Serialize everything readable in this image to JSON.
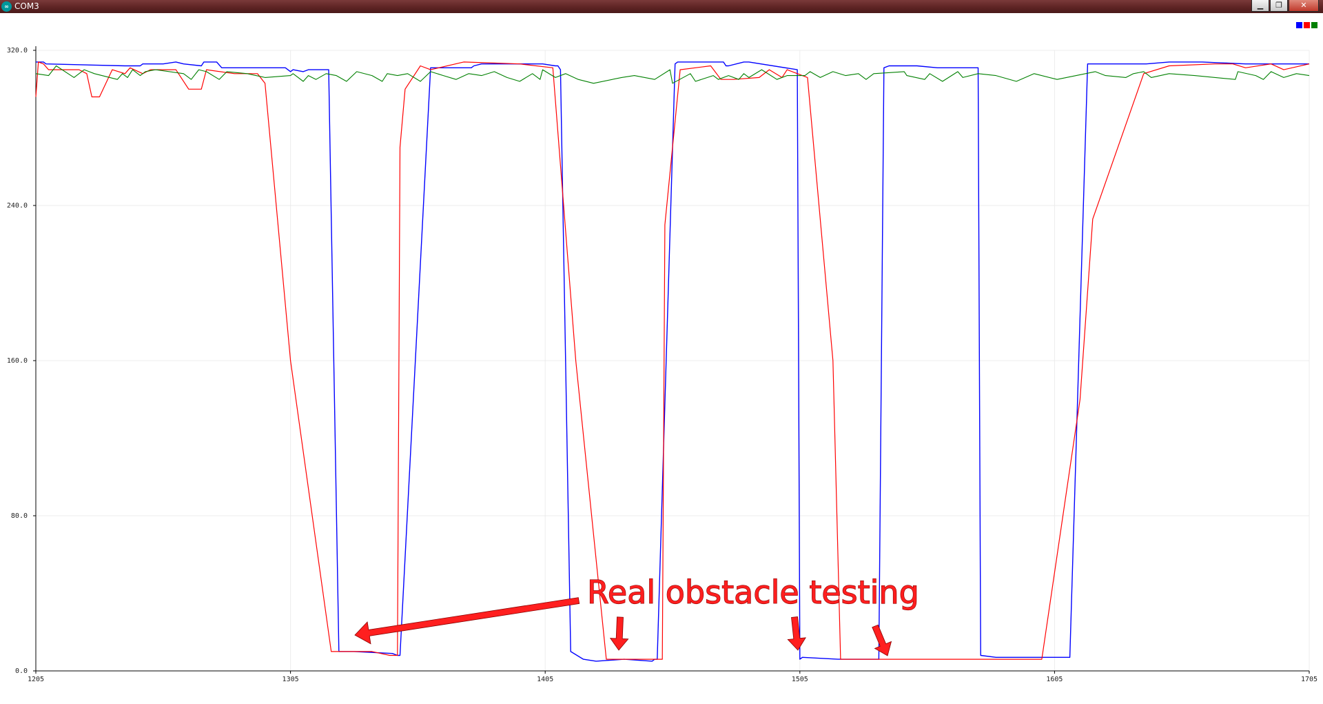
{
  "window": {
    "title": "COM3",
    "app_icon": "arduino-logo-icon",
    "buttons": [
      {
        "name": "minimize-button",
        "icon": "minimize-icon",
        "glyph": "▁"
      },
      {
        "name": "restore-button",
        "icon": "restore-icon",
        "glyph": "❐"
      },
      {
        "name": "close-button",
        "icon": "close-icon",
        "glyph": "✕"
      }
    ]
  },
  "legend": {
    "placement": "top-right",
    "colors": [
      "#0000ff",
      "#ff0000",
      "#008000"
    ]
  },
  "annotation": {
    "text": "Real obstacle testing",
    "color": "#ff1f1f"
  },
  "chart_data": {
    "type": "line",
    "title": "",
    "xlabel": "",
    "ylabel": "",
    "xlim": [
      1205,
      1705
    ],
    "ylim": [
      0,
      320
    ],
    "grid": true,
    "x_ticks": [
      1205,
      1305,
      1405,
      1505,
      1605,
      1705
    ],
    "x_tick_labels": [
      "1205",
      "1305",
      "1405",
      "1505",
      "1605",
      "1705"
    ],
    "y_ticks": [
      0,
      80,
      160,
      240,
      320
    ],
    "y_tick_labels": [
      "0.0",
      "80.0",
      "160.0",
      "240.0",
      "320.0"
    ],
    "series": [
      {
        "color": "#0000ff",
        "x": [
          1205,
          1208,
          1209,
          1240,
          1246,
          1247,
          1255,
          1260,
          1263,
          1270,
          1271,
          1272,
          1276,
          1278,
          1298,
          1303,
          1305,
          1306,
          1310,
          1312,
          1320,
          1324,
          1330,
          1345,
          1347,
          1348,
          1360,
          1376,
          1377,
          1380,
          1384,
          1404,
          1409,
          1410,
          1411,
          1415,
          1420,
          1425,
          1436,
          1447,
          1448,
          1449,
          1456,
          1457,
          1460,
          1475,
          1476,
          1477,
          1483,
          1485,
          1504,
          1505,
          1506,
          1520,
          1524,
          1536,
          1538,
          1540,
          1551,
          1559,
          1575,
          1576,
          1582,
          1597,
          1598,
          1611,
          1618,
          1627,
          1641,
          1650,
          1663,
          1680,
          1701,
          1705
        ],
        "y": [
          314,
          314,
          313,
          312,
          312,
          313,
          313,
          314,
          313,
          312,
          314,
          314,
          314,
          311,
          311,
          311,
          309,
          310,
          309,
          310,
          310,
          10,
          10,
          9,
          8,
          8,
          311,
          311,
          312,
          313,
          313,
          313,
          312,
          312,
          310,
          10,
          6,
          5,
          6,
          5,
          6,
          6,
          313,
          314,
          314,
          314,
          312,
          312,
          314,
          314,
          310,
          6,
          7,
          6,
          6,
          6,
          311,
          312,
          312,
          311,
          311,
          8,
          7,
          7,
          7,
          7,
          313,
          313,
          313,
          314,
          314,
          313,
          313,
          313
        ],
        "width": 1.4
      },
      {
        "color": "#ff0000",
        "x": [
          1205,
          1206,
          1208,
          1210,
          1222,
          1225,
          1227,
          1230,
          1235,
          1240,
          1242,
          1247,
          1250,
          1260,
          1265,
          1270,
          1272,
          1283,
          1292,
          1295,
          1305,
          1321,
          1337,
          1344,
          1347,
          1348,
          1350,
          1353,
          1356,
          1360,
          1373,
          1395,
          1408,
          1417,
          1429,
          1444,
          1448,
          1451,
          1452,
          1458,
          1470,
          1474,
          1479,
          1489,
          1493,
          1498,
          1500,
          1508,
          1518,
          1521,
          1522,
          1524,
          1530,
          1537,
          1544,
          1552,
          1559,
          1580,
          1600,
          1615,
          1620,
          1640,
          1650,
          1668,
          1675,
          1680,
          1690,
          1695,
          1705
        ],
        "y": [
          296,
          314,
          313,
          310,
          310,
          308,
          296,
          296,
          310,
          308,
          311,
          308,
          310,
          310,
          300,
          300,
          310,
          308,
          308,
          303,
          160,
          10,
          10,
          8,
          8,
          270,
          300,
          306,
          312,
          310,
          314,
          313,
          311,
          160,
          6,
          6,
          6,
          6,
          230,
          310,
          312,
          305,
          305,
          306,
          310,
          306,
          310,
          306,
          160,
          6,
          6,
          6,
          6,
          6,
          6,
          6,
          6,
          6,
          6,
          140,
          233,
          308,
          312,
          313,
          313,
          311,
          313,
          310,
          313
        ],
        "width": 1.2
      },
      {
        "color": "#008000",
        "x": [
          1205,
          1210,
          1213,
          1220,
          1224,
          1228,
          1237,
          1239,
          1241,
          1243,
          1246,
          1248,
          1252,
          1263,
          1266,
          1269,
          1272,
          1277,
          1280,
          1288,
          1295,
          1305,
          1306,
          1310,
          1312,
          1315,
          1319,
          1323,
          1327,
          1331,
          1337,
          1341,
          1343,
          1347,
          1351,
          1356,
          1360,
          1365,
          1370,
          1375,
          1380,
          1385,
          1390,
          1395,
          1400,
          1403,
          1404,
          1409,
          1413,
          1418,
          1424,
          1435,
          1440,
          1448,
          1454,
          1455,
          1462,
          1464,
          1471,
          1473,
          1477,
          1481,
          1483,
          1485,
          1490,
          1496,
          1500,
          1504,
          1507,
          1509,
          1513,
          1518,
          1523,
          1528,
          1531,
          1534,
          1546,
          1547,
          1554,
          1556,
          1561,
          1567,
          1569,
          1575,
          1582,
          1590,
          1597,
          1606,
          1621,
          1625,
          1633,
          1636,
          1640,
          1643,
          1650,
          1660,
          1676,
          1677,
          1684,
          1687,
          1690,
          1695,
          1700,
          1705
        ],
        "y": [
          308,
          307,
          312,
          306,
          310,
          308,
          305,
          308,
          306,
          310,
          307,
          309,
          310,
          308,
          305,
          310,
          309,
          305,
          309,
          308,
          306,
          307,
          308,
          304,
          307,
          305,
          308,
          307,
          304,
          309,
          307,
          304,
          308,
          307,
          308,
          304,
          309,
          307,
          305,
          308,
          307,
          309,
          306,
          304,
          308,
          305,
          310,
          306,
          308,
          305,
          303,
          306,
          307,
          305,
          310,
          303,
          308,
          304,
          307,
          305,
          307,
          305,
          308,
          306,
          310,
          305,
          307,
          307,
          307,
          309,
          306,
          309,
          307,
          308,
          305,
          308,
          309,
          307,
          305,
          308,
          304,
          309,
          306,
          308,
          307,
          304,
          308,
          305,
          309,
          307,
          306,
          308,
          309,
          306,
          308,
          307,
          305,
          309,
          307,
          305,
          309,
          306,
          308,
          307
        ],
        "width": 1.1
      }
    ]
  }
}
